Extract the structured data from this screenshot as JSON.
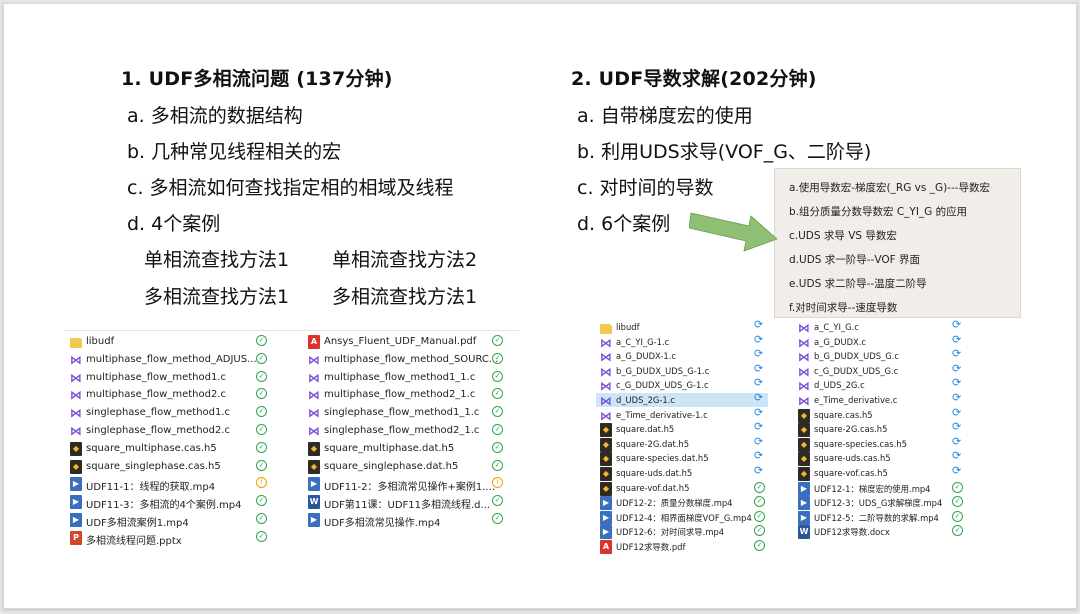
{
  "left": {
    "heading": "1. UDF多相流问题 (137分钟)",
    "items": [
      "a. 多相流的数据结构",
      "b. 几种常见线程相关的宏",
      "c. 多相流如何查找指定相的相域及线程",
      "d. 4个案例"
    ],
    "cases": [
      "单相流查找方法1",
      "单相流查找方法2",
      "多相流查找方法1",
      "多相流查找方法1"
    ]
  },
  "right": {
    "heading": "2. UDF导数求解(202分钟)",
    "items": [
      "a. 自带梯度宏的使用",
      "b. 利用UDS求导(VOF_G、二阶导)",
      "c. 对时间的导数",
      "d. 6个案例"
    ]
  },
  "popup": [
    "a.使用导数宏-梯度宏(_RG vs _G)---导数宏",
    "b.组分质量分数导数宏 C_YI_G 的应用",
    "c.UDS 求导 VS 导数宏",
    "d.UDS 求一阶导--VOF 界面",
    "e.UDS 求二阶导--温度二阶导",
    "f.对时间求导--速度导数"
  ],
  "files_left_col1": [
    {
      "name": "libudf",
      "icon": "folder",
      "status": "ok"
    },
    {
      "name": "multiphase_flow_method_ADJUS...",
      "icon": "vs",
      "status": "ok"
    },
    {
      "name": "multiphase_flow_method1.c",
      "icon": "vs",
      "status": "ok"
    },
    {
      "name": "multiphase_flow_method2.c",
      "icon": "vs",
      "status": "ok"
    },
    {
      "name": "singlephase_flow_method1.c",
      "icon": "vs",
      "status": "ok"
    },
    {
      "name": "singlephase_flow_method2.c",
      "icon": "vs",
      "status": "ok"
    },
    {
      "name": "square_multiphase.cas.h5",
      "icon": "h5",
      "status": "ok"
    },
    {
      "name": "square_singlephase.cas.h5",
      "icon": "h5",
      "status": "ok"
    },
    {
      "name": "UDF11-1：线程的获取.mp4",
      "icon": "mp4",
      "status": "warn"
    },
    {
      "name": "UDF11-3：多相流的4个案例.mp4",
      "icon": "mp4",
      "status": "ok"
    },
    {
      "name": "UDF多相流案例1.mp4",
      "icon": "mp4",
      "status": "ok"
    },
    {
      "name": "多相流线程问题.pptx",
      "icon": "ppt",
      "status": "ok"
    }
  ],
  "files_left_col2": [
    {
      "name": "Ansys_Fluent_UDF_Manual.pdf",
      "icon": "pdf",
      "status": "ok"
    },
    {
      "name": "multiphase_flow_method_SOURC...",
      "icon": "vs",
      "status": "ok"
    },
    {
      "name": "multiphase_flow_method1_1.c",
      "icon": "vs",
      "status": "ok"
    },
    {
      "name": "multiphase_flow_method2_1.c",
      "icon": "vs",
      "status": "ok"
    },
    {
      "name": "singlephase_flow_method1_1.c",
      "icon": "vs",
      "status": "ok"
    },
    {
      "name": "singlephase_flow_method2_1.c",
      "icon": "vs",
      "status": "ok"
    },
    {
      "name": "square_multiphase.dat.h5",
      "icon": "h5",
      "status": "ok"
    },
    {
      "name": "square_singlephase.dat.h5",
      "icon": "h5",
      "status": "ok"
    },
    {
      "name": "UDF11-2：多相流常见操作+案例1....",
      "icon": "mp4",
      "status": "warn"
    },
    {
      "name": "UDF第11课：UDF11多相流线程.d...",
      "icon": "doc",
      "status": "ok"
    },
    {
      "name": "UDF多相流常见操作.mp4",
      "icon": "mp4",
      "status": "ok"
    }
  ],
  "files_right_col1": [
    {
      "name": "libudf",
      "icon": "folder",
      "status": "sync"
    },
    {
      "name": "a_C_YI_G-1.c",
      "icon": "vs",
      "status": "sync"
    },
    {
      "name": "a_G_DUDX-1.c",
      "icon": "vs",
      "status": "sync"
    },
    {
      "name": "b_G_DUDX_UDS_G-1.c",
      "icon": "vs",
      "status": "sync"
    },
    {
      "name": "c_G_DUDX_UDS_G-1.c",
      "icon": "vs",
      "status": "sync"
    },
    {
      "name": "d_UDS_2G-1.c",
      "icon": "vs",
      "status": "sync",
      "selected": true
    },
    {
      "name": "e_Time_derivative-1.c",
      "icon": "vs",
      "status": "sync"
    },
    {
      "name": "square.dat.h5",
      "icon": "h5",
      "status": "sync"
    },
    {
      "name": "square-2G.dat.h5",
      "icon": "h5",
      "status": "sync"
    },
    {
      "name": "square-species.dat.h5",
      "icon": "h5",
      "status": "sync"
    },
    {
      "name": "square-uds.dat.h5",
      "icon": "h5",
      "status": "sync"
    },
    {
      "name": "square-vof.dat.h5",
      "icon": "h5",
      "status": "ok"
    },
    {
      "name": "UDF12-2：质量分数梯度.mp4",
      "icon": "mp4",
      "status": "ok"
    },
    {
      "name": "UDF12-4：相界面梯度VOF_G.mp4",
      "icon": "mp4",
      "status": "ok"
    },
    {
      "name": "UDF12-6：对时间求导.mp4",
      "icon": "mp4",
      "status": "ok"
    },
    {
      "name": "UDF12求导数.pdf",
      "icon": "pdf",
      "status": "ok"
    }
  ],
  "files_right_col2": [
    {
      "name": "a_C_YI_G.c",
      "icon": "vs",
      "status": "sync"
    },
    {
      "name": "a_G_DUDX.c",
      "icon": "vs",
      "status": "sync"
    },
    {
      "name": "b_G_DUDX_UDS_G.c",
      "icon": "vs",
      "status": "sync"
    },
    {
      "name": "c_G_DUDX_UDS_G.c",
      "icon": "vs",
      "status": "sync"
    },
    {
      "name": "d_UDS_2G.c",
      "icon": "vs",
      "status": "sync"
    },
    {
      "name": "e_Time_derivative.c",
      "icon": "vs",
      "status": "sync"
    },
    {
      "name": "square.cas.h5",
      "icon": "h5",
      "status": "sync"
    },
    {
      "name": "square-2G.cas.h5",
      "icon": "h5",
      "status": "sync"
    },
    {
      "name": "square-species.cas.h5",
      "icon": "h5",
      "status": "sync"
    },
    {
      "name": "square-uds.cas.h5",
      "icon": "h5",
      "status": "sync"
    },
    {
      "name": "square-vof.cas.h5",
      "icon": "h5",
      "status": "sync"
    },
    {
      "name": "UDF12-1：梯度宏的使用.mp4",
      "icon": "mp4",
      "status": "ok"
    },
    {
      "name": "UDF12-3：UDS_G求解梯度.mp4",
      "icon": "mp4",
      "status": "ok"
    },
    {
      "name": "UDF12-5：二阶导数的求解.mp4",
      "icon": "mp4",
      "status": "ok"
    },
    {
      "name": "UDF12求导数.docx",
      "icon": "doc",
      "status": "ok"
    }
  ],
  "icon_glyphs": {
    "folder": "",
    "vs": "⋈",
    "pdf": "A",
    "ppt": "P",
    "mp4": "▶",
    "h5": "◆",
    "doc": "W"
  },
  "status_glyphs": {
    "ok": "✓",
    "warn": "!",
    "sync": "⟳"
  },
  "arrow_color": "#8fbf72"
}
